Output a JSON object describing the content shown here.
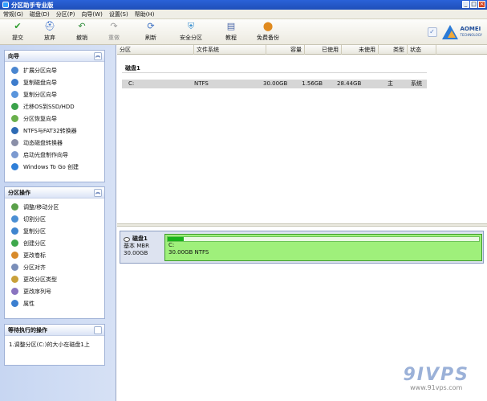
{
  "window": {
    "title": "分区助手专业版"
  },
  "menu": [
    "常规(G)",
    "磁盘(D)",
    "分区(P)",
    "向导(W)",
    "设置(S)",
    "帮助(H)"
  ],
  "toolbar": [
    {
      "label": "提交",
      "icon": "check-icon",
      "enabled": true
    },
    {
      "label": "放弃",
      "icon": "discard-icon",
      "enabled": true
    },
    {
      "label": "撤销",
      "icon": "undo-icon",
      "enabled": true
    },
    {
      "label": "重做",
      "icon": "redo-icon",
      "enabled": false
    },
    {
      "label": "刷新",
      "icon": "refresh-icon",
      "enabled": true
    },
    {
      "label": "安全分区",
      "icon": "safe-partition-icon",
      "enabled": true
    },
    {
      "label": "教程",
      "icon": "tutorial-icon",
      "enabled": true
    },
    {
      "label": "免费备份",
      "icon": "backup-icon",
      "enabled": true
    }
  ],
  "logo": {
    "brand": "AOMEI",
    "sub": "TECHNOLOGY"
  },
  "wizard": {
    "title": "向导",
    "items": [
      "扩展分区向导",
      "复制磁盘向导",
      "复制分区向导",
      "迁移OS到SSD/HDD",
      "分区恢复向导",
      "NTFS与FAT32转换器",
      "动态磁盘转换器",
      "启动光盘制作向导",
      "Windows To Go 创建"
    ]
  },
  "partition_ops": {
    "title": "分区操作",
    "items": [
      "调整/移动分区",
      "切割分区",
      "复制分区",
      "创建分区",
      "更改卷标",
      "分区对齐",
      "更改分区类型",
      "更改序列号",
      "属性"
    ]
  },
  "pending": {
    "title": "等待执行的操作",
    "items": [
      "1.调整分区(C:)的大小在磁盘1上"
    ]
  },
  "table": {
    "headers": [
      "分区",
      "文件系统",
      "容量",
      "已使用",
      "未使用",
      "类型",
      "状态"
    ],
    "disk_label": "磁盘1",
    "rows": [
      {
        "partition": "C:",
        "fs": "NTFS",
        "capacity": "30.00GB",
        "used": "1.56GB",
        "free": "28.44GB",
        "type": "主",
        "status": "系统"
      }
    ]
  },
  "diskmap": {
    "name": "磁盘1",
    "kind": "基本 MBR",
    "size": "30.00GB",
    "partition_letter": "C:",
    "partition_desc": "30.00GB NTFS",
    "used_fraction": 0.052
  },
  "watermark": {
    "logo": "9IVPS",
    "url": "www.91vps.com"
  }
}
